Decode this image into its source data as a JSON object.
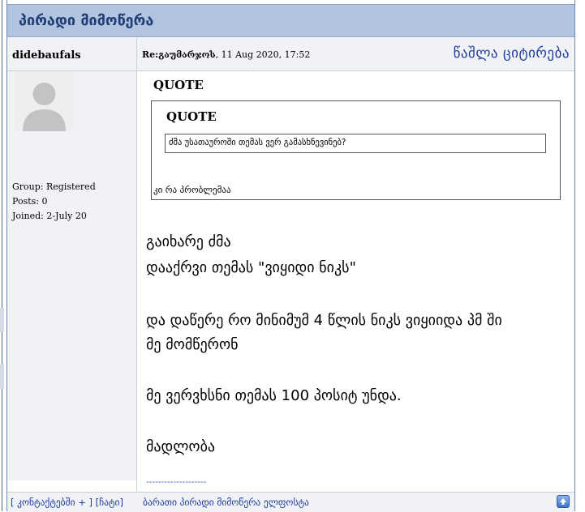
{
  "topic": {
    "title": "პირადი მიმოწერა"
  },
  "post": {
    "author": "didebaufals",
    "meta_prefix": "Re:",
    "meta_subject": "გაუმარჯოს",
    "meta_date": ", 11 Aug 2020, 17:52",
    "quote_button": "წაშლა  ციტირება"
  },
  "user": {
    "group": "Group: Registered",
    "posts": "Posts: 0",
    "joined": "Joined: 2-July 20"
  },
  "quote_outer": {
    "label": "QUOTE",
    "reply": "კი რა პრობლემაა"
  },
  "quote_inner": {
    "label": "QUOTE",
    "text": "ძმა უსათაუროში თემას ვერ გამასხნევინებ?"
  },
  "message": {
    "line1": "გაიხარე ძმა",
    "line2": "დააქრვი თემას \"ვიყიდი ნიკს\"",
    "line3": "და დაწერე რო მინიმუმ 4 წლის ნიკს ვიყიიდა პმ ში",
    "line4": "მე მომწერონ",
    "line5": "მე ვერვხსნი თემას 100 პოსიტ უნდა.",
    "line6": "მადლობა"
  },
  "signature": "--------------------",
  "footer": {
    "left": "[ კონტაქტებში + ] [ჩატი]",
    "middle": "ბარათი პირადი მიმოწერა ელფოსტა"
  },
  "colors": {
    "title_bar": "#b3c4e0",
    "title_text": "#1f3e76",
    "link": "#1f3e9c",
    "row_bg": "#f0f2f6"
  }
}
